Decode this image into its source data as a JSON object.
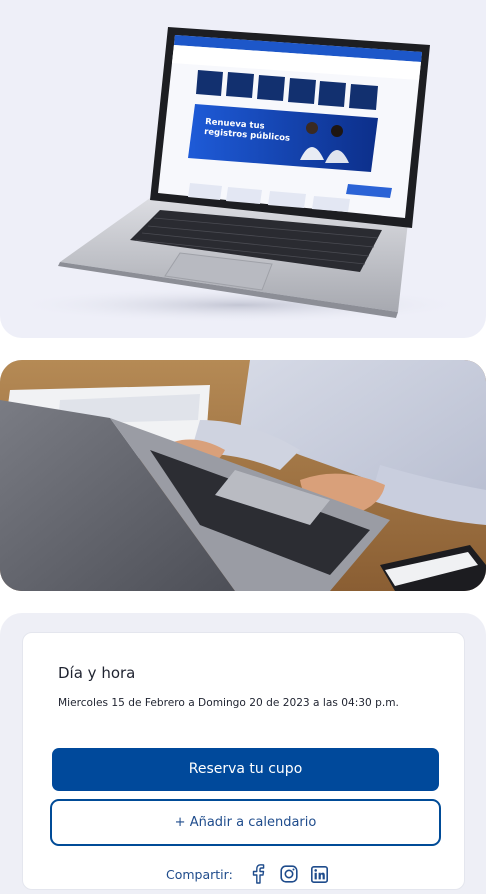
{
  "hero": {
    "screen": {
      "banner_title_line1": "Renueva tus",
      "banner_title_line2": "registros públicos"
    }
  },
  "event": {
    "title": "Día y hora",
    "dates": "Miercoles 15 de Febrero a Domingo 20 de 2023 a las 04:30 p.m.",
    "reserve_label": "Reserva tu cupo",
    "calendar_label": "+ Añadir a calendario",
    "share_label": "Compartir:",
    "share_icons": [
      "facebook-icon",
      "instagram-icon",
      "linkedin-icon"
    ]
  },
  "colors": {
    "primary": "#00499b",
    "accent_text": "#1f4c8c",
    "card_bg": "#eeeff6"
  }
}
